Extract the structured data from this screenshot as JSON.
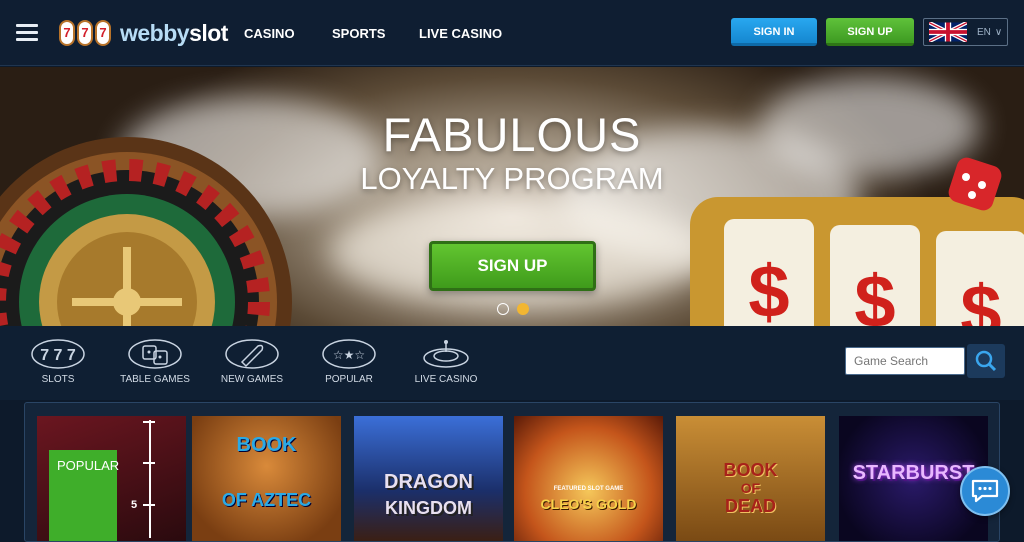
{
  "header": {
    "logo": {
      "part1": "webby",
      "part2": "slot",
      "badge": "777"
    },
    "nav": [
      "CASINO",
      "SPORTS",
      "LIVE CASINO"
    ],
    "sign_in": "SIGN IN",
    "sign_up": "SIGN UP",
    "language": {
      "code": "EN",
      "flag": "uk-flag"
    }
  },
  "hero": {
    "title": "FABULOUS",
    "subtitle": "LOYALTY PROGRAM",
    "cta": "SIGN UP",
    "slides_total": 2,
    "active_slide": 2
  },
  "categories": [
    {
      "label": "SLOTS",
      "icon": "slots-icon"
    },
    {
      "label": "TABLE GAMES",
      "icon": "dice-icon"
    },
    {
      "label": "NEW GAMES",
      "icon": "rocket-icon"
    },
    {
      "label": "POPULAR",
      "icon": "stars-icon"
    },
    {
      "label": "LIVE CASINO",
      "icon": "roulette-icon"
    }
  ],
  "search": {
    "placeholder": "Game Search"
  },
  "games": [
    {
      "badge": "POPULAR",
      "scale_value": "5"
    },
    {
      "title_line1": "BOOK",
      "title_line2": "OF AZTEC"
    },
    {
      "title_line1": "DRAGON",
      "title_line2": "KINGDOM"
    },
    {
      "title_top": "FEATURED SLOT GAME",
      "title_line1": "CLEO'S GOLD"
    },
    {
      "title_line1": "BOOK",
      "title_line2": "OF",
      "title_line3": "DEAD"
    },
    {
      "title_line1": "STARBURST"
    }
  ],
  "colors": {
    "header_bg": "#0f1e32",
    "sign_in": "#1f97e0",
    "sign_up": "#4caf2c",
    "dot_active": "#f2b632"
  }
}
